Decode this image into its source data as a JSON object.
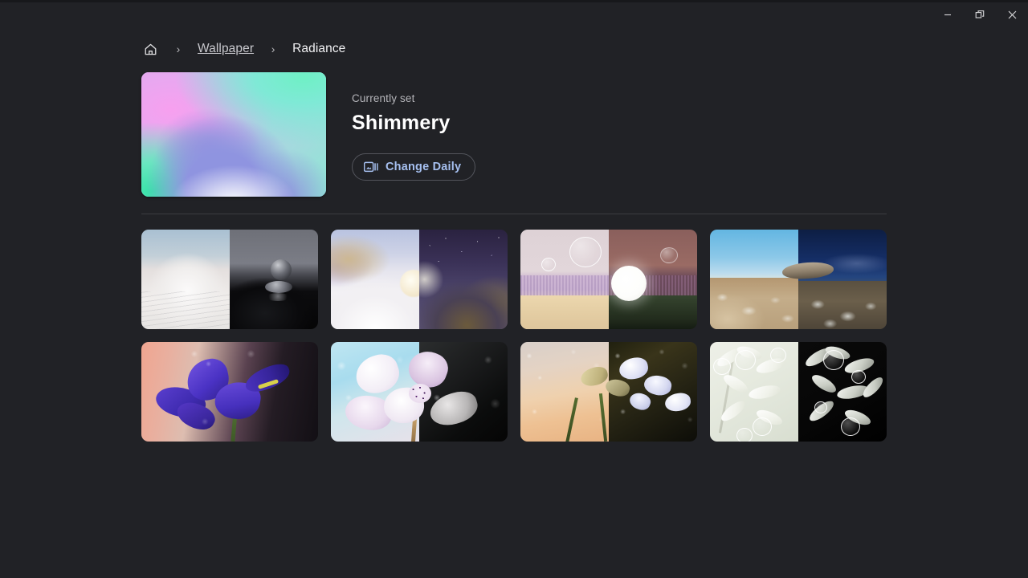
{
  "window": {
    "controls": [
      {
        "name": "minimize",
        "glyph": "minimize-icon",
        "tooltip": "Minimize"
      },
      {
        "name": "restore",
        "glyph": "restore-icon",
        "tooltip": "Restore"
      },
      {
        "name": "close",
        "glyph": "close-icon",
        "tooltip": "Close"
      }
    ]
  },
  "breadcrumb": {
    "home_icon": "home-icon",
    "separator": "›",
    "items": [
      {
        "label": "Wallpaper",
        "current": false
      },
      {
        "label": "Radiance",
        "current": true
      }
    ]
  },
  "hero": {
    "subtitle": "Currently set",
    "title": "Shimmery",
    "button": {
      "label": "Change Daily",
      "icon": "slideshow-icon",
      "accent_color": "#a6c0f0",
      "border_color": "#53555c"
    }
  },
  "theme": {
    "background": "#212226",
    "titlebar_edge": "#17181b",
    "divider": "#3b3c41",
    "text_primary": "#f2f2f4",
    "text_secondary": "#b5b5ba",
    "accent": "#a6c0f0"
  },
  "gallery": {
    "items": [
      {
        "name": "dunes",
        "alt": "Sand dune light and dark variants"
      },
      {
        "name": "snowy-slope",
        "alt": "Snowy slope with moon, light and dark variants"
      },
      {
        "name": "bubbles-field",
        "alt": "Bubbles over a field, light and dark variants"
      },
      {
        "name": "desert-rock",
        "alt": "Desert rock under blue sky, light and dark variants"
      },
      {
        "name": "iris",
        "alt": "Purple iris flower, light and dark variants"
      },
      {
        "name": "orchid",
        "alt": "Orchid with water drops, light and dark variants"
      },
      {
        "name": "freesia",
        "alt": "Freesia flowers, light and dark variants"
      },
      {
        "name": "white-leaves",
        "alt": "White leaves with bubbles, light and dark variants"
      }
    ]
  }
}
